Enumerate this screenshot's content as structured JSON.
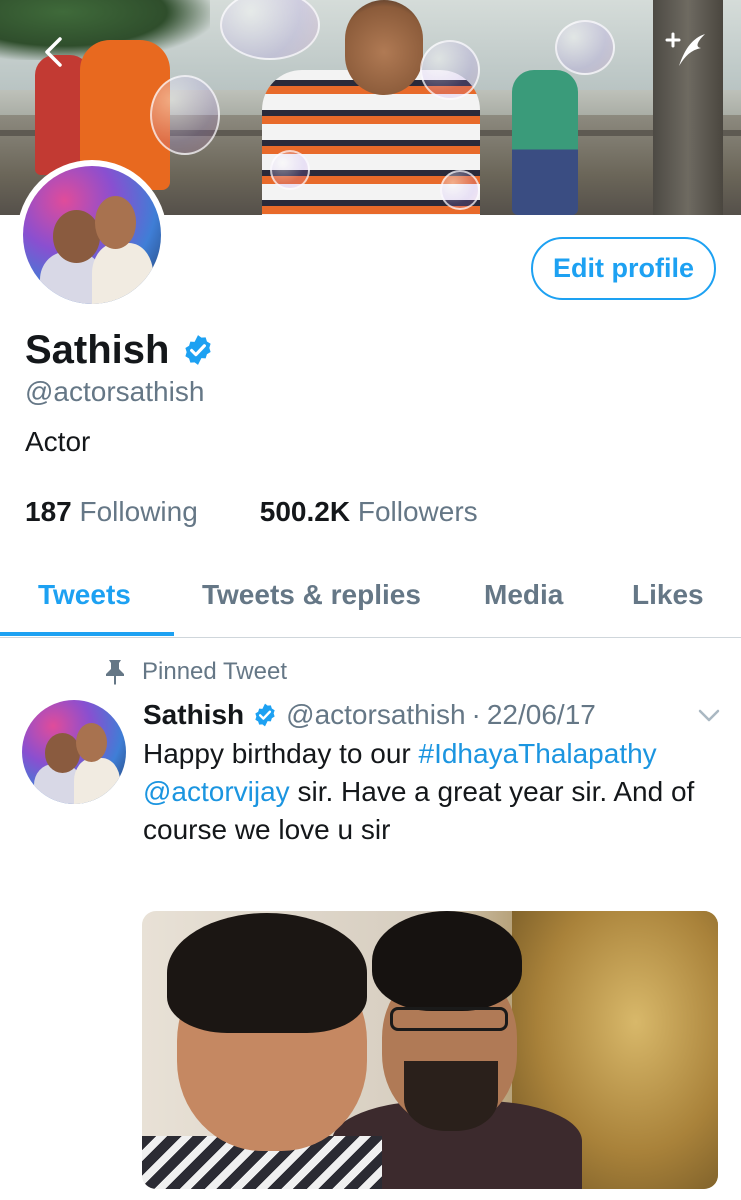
{
  "header": {
    "back_icon": "chevron-left-icon",
    "compose_icon": "compose-tweet-icon"
  },
  "profile": {
    "name": "Sathish",
    "handle": "@actorsathish",
    "bio": "Actor",
    "edit_label": "Edit profile",
    "following_count": "187",
    "following_label": "Following",
    "followers_count": "500.2K",
    "followers_label": "Followers"
  },
  "tabs": [
    {
      "label": "Tweets",
      "active": true
    },
    {
      "label": "Tweets & replies",
      "active": false
    },
    {
      "label": "Media",
      "active": false
    },
    {
      "label": "Likes",
      "active": false
    }
  ],
  "pinned_tweet": {
    "pinned_label": "Pinned Tweet",
    "name": "Sathish",
    "handle": "@actorsathish",
    "separator": "·",
    "date": "22/06/17",
    "text_part1": "Happy birthday to our ",
    "hashtag": "#IdhayaThalapathy",
    "space": " ",
    "mention": "@actorvijay",
    "text_part2": " sir. Have a great year sir. And of course we love u sir"
  },
  "colors": {
    "accent": "#1da1f2",
    "secondary_text": "#657786",
    "primary_text": "#14171a"
  }
}
